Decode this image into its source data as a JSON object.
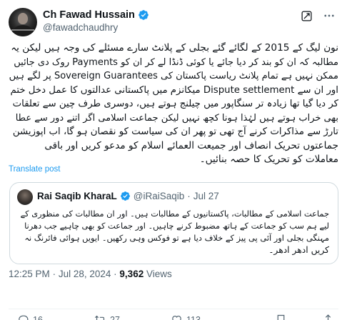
{
  "author": {
    "name": "Ch Fawad Hussain",
    "handle": "@fawadchaudhry"
  },
  "body_lines": [
    "نون لیگ کے 2015 کے لگائے گئے بجلی کے پلانٹ سارے مسئلے کی وجہ ہیں لیکن یہ",
    "مطالبہ کہ ان کو بند کر دیا جائے یا کوئی ڈنڈا لے کر ان کو Payments روک دی جائیں",
    "ممکن نہیں ہے تمام پلانٹ ریاست پاکستان کی Sovereign Guarantees پر لگے ہیں",
    "اور ان سے Dispute settlement میکانزم میں پاکستانی عدالتوں کا عمل دخل ختم",
    "کر دیا گیا تھا زیادہ تر سنگاپور میں چیلنج ہوتے ہیں، دوسری طرف چین سے تعلقات",
    "بھی خراب ہوتے ہیں لہٰذا ہونا کچھ نہیں لیکن جماعت اسلامی اگر اتنے دور سے عطا",
    "تارڑ سے مذاکرات کرنے آج تھی تو پھر ان کی سیاست کو نقصان ہو گا، اب اپوزیشن",
    "جماعتوں تحریک انصاف اور جمیعت العمائے اسلام کو مدعو کریں اور باقی",
    "معاملات کو تحریک کا حصہ بنائیں۔"
  ],
  "translate_label": "Translate post",
  "quote": {
    "name": "Rai Saqib KharaL",
    "handle": "@iRaiSaqib",
    "separator": "·",
    "date": "Jul 27",
    "lines": [
      "جماعت اسلامی کے مطالبات، پاکستانیوں کے مطالبات ہیں۔ اور ان مطالبات کی منظوری کے",
      "لیے ہم سب کو جماعت کے ہاتھ مضبوط کرنے چاہیں۔ اور جماعت کو بھی چاہیے جب دھرنا",
      "مہنگی بجلی اور آئی پی پیز کے خلاف دیا ہے تو فوکس وہی رکھیں۔ ایویں ہوائی فائرنگ نہ",
      "کریں ادھر ادھر۔"
    ]
  },
  "meta": {
    "time": "12:25 PM",
    "separator": "·",
    "date": "Jul 28, 2024",
    "views_count": "9,362",
    "views_label": "Views"
  },
  "actions": {
    "replies": "16",
    "reposts": "27",
    "likes": "113"
  },
  "colors": {
    "accent": "#1d9bf0",
    "secondary_text": "#536471",
    "primary_text": "#0f1419",
    "border": "#cfd9de"
  },
  "icons": [
    "verified-badge-icon",
    "grok-icon",
    "more-icon",
    "reply-icon",
    "repost-icon",
    "like-icon",
    "bookmark-icon",
    "share-icon"
  ]
}
